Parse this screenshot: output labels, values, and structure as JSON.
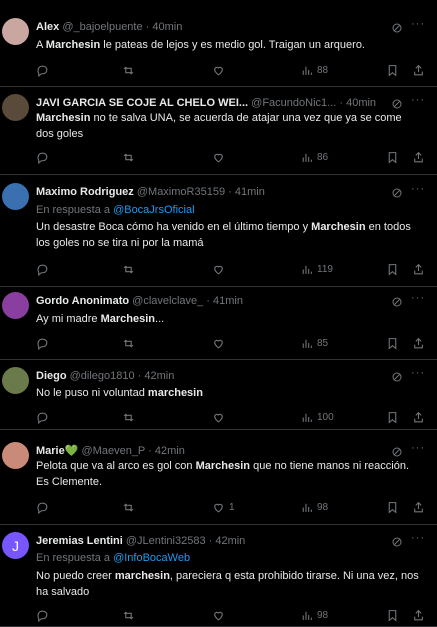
{
  "tweets": [
    {
      "name": "Alex",
      "handle": "@_bajoelpuente",
      "time": "40min",
      "reply_to_prefix": "",
      "reply_to": "",
      "text_pre": "A ",
      "text_bold": "Marchesin",
      "text_post": " le pateas de lejos y es medio gol. Traigan un arquero.",
      "replies": "",
      "retweets": "",
      "likes": "",
      "views": "88",
      "avatar_color": "#c9a6a0"
    },
    {
      "name": "JAVI GARCIA SE COJE AL CHELO WEI...",
      "handle": "@FacundoNic1...",
      "time": "40min",
      "reply_to_prefix": "",
      "reply_to": "",
      "text_pre": "",
      "text_bold": "Marchesin",
      "text_post": " no te salva UNA, se acuerda de atajar una vez que ya se come dos goles",
      "replies": "",
      "retweets": "",
      "likes": "",
      "views": "86",
      "avatar_color": "#5a4a3a"
    },
    {
      "name": "Maximo Rodriguez",
      "handle": "@MaximoR35159",
      "time": "41min",
      "reply_to_prefix": "En respuesta a ",
      "reply_to": "@BocaJrsOficial",
      "text_pre": "Un desastre Boca cómo ha venido en el último tiempo y ",
      "text_bold": "Marchesin",
      "text_post": " en todos los goles no se tira ni por la mamá",
      "replies": "",
      "retweets": "",
      "likes": "",
      "views": "119",
      "avatar_color": "#3a6fb0"
    },
    {
      "name": "Gordo Anonimato",
      "handle": "@clavelclave_",
      "time": "41min",
      "reply_to_prefix": "",
      "reply_to": "",
      "text_pre": "Ay mi madre ",
      "text_bold": "Marchesin",
      "text_post": "...",
      "replies": "",
      "retweets": "",
      "likes": "",
      "views": "85",
      "avatar_color": "#8a3fa0"
    },
    {
      "name": "Diego",
      "handle": "@dilego1810",
      "time": "42min",
      "reply_to_prefix": "",
      "reply_to": "",
      "text_pre": "No le puso ni voluntad ",
      "text_bold": "marchesin",
      "text_post": "",
      "replies": "",
      "retweets": "",
      "likes": "",
      "views": "100",
      "avatar_color": "#6b7a4a"
    },
    {
      "name": "Marie",
      "name_emoji": "💚",
      "handle": "@Maeven_P",
      "time": "42min",
      "reply_to_prefix": "",
      "reply_to": "",
      "text_pre": "Pelota que va al arco es gol con ",
      "text_bold": "Marchesin",
      "text_post": " que no tiene manos ni reacción. Es Clemente.",
      "replies": "",
      "retweets": "",
      "likes": "1",
      "views": "98",
      "avatar_color": "#c98a7a"
    },
    {
      "name": "Jeremias Lentini",
      "handle": "@JLentini32583",
      "time": "42min",
      "reply_to_prefix": "En respuesta a ",
      "reply_to": "@InfoBocaWeb",
      "text_pre": "No puedo creer ",
      "text_bold": "marchesin",
      "text_post": ", pareciera q esta prohibido tirarse. Ni una vez, nos ha salvado",
      "replies": "",
      "retweets": "",
      "likes": "",
      "views": "98",
      "avatar_letter": "J",
      "avatar_color": "#7856ff"
    }
  ],
  "colors": {
    "background": "#000000",
    "text": "#e7e9ea",
    "muted": "#71767b",
    "link": "#1d9bf0",
    "border": "#2f3336"
  },
  "icons": [
    "reply-icon",
    "retweet-icon",
    "like-icon",
    "views-icon",
    "bookmark-icon",
    "share-icon",
    "grok-icon",
    "more-icon"
  ]
}
